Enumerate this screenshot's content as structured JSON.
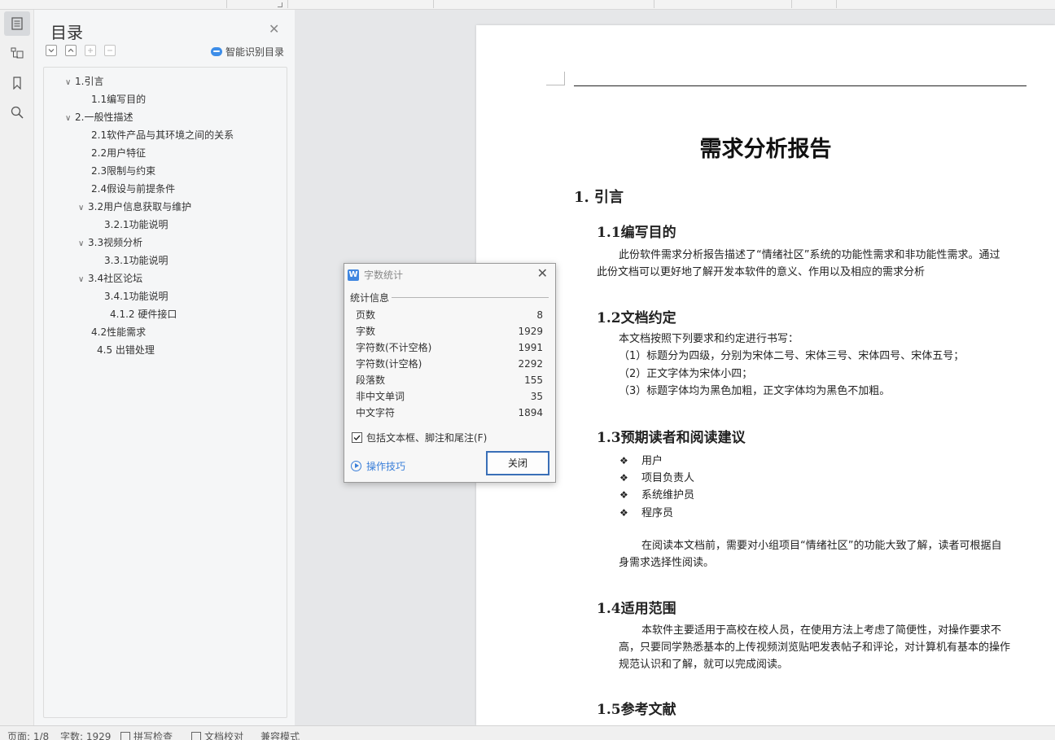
{
  "nav": {
    "title": "目录",
    "smart_toc_label": "智能识别目录",
    "items": [
      {
        "label": "1.引言",
        "level": 1,
        "expanded": true
      },
      {
        "label": "1.1编写目的",
        "level": 2
      },
      {
        "label": "2.一般性描述",
        "level": 1,
        "expanded": true
      },
      {
        "label": "2.1软件产品与其环境之间的关系",
        "level": 2
      },
      {
        "label": "2.2用户特征",
        "level": 2
      },
      {
        "label": "2.3限制与约束",
        "level": 2
      },
      {
        "label": "2.4假设与前提条件",
        "level": 2
      },
      {
        "label": "3.2用户信息获取与维护",
        "level": 2,
        "expanded": true
      },
      {
        "label": "3.2.1功能说明",
        "level": 3
      },
      {
        "label": "3.3视频分析",
        "level": 2,
        "expanded": true
      },
      {
        "label": "3.3.1功能说明",
        "level": 3
      },
      {
        "label": "3.4社区论坛",
        "level": 2,
        "expanded": true
      },
      {
        "label": "3.4.1功能说明",
        "level": 3
      },
      {
        "label": "4.1.2 硬件接口",
        "level": 3
      },
      {
        "label": "4.2性能需求",
        "level": 2
      },
      {
        "label": "4.5 出错处理",
        "level": 2
      }
    ]
  },
  "document": {
    "title": "需求分析报告",
    "h1_intro": "1.  引言",
    "s11_title": "1.1编写目的",
    "s11_p1": "此份软件需求分析报告描述了“情绪社区”系统的功能性需求和非功能性需求。通过",
    "s11_p2": "此份文档可以更好地了解开发本软件的意义、作用以及相应的需求分析",
    "s12_title": "1.2文档约定",
    "s12_lines": [
      "本文档按照下列要求和约定进行书写：",
      "（1）标题分为四级，分别为宋体二号、宋体三号、宋体四号、宋体五号；",
      "（2）正文字体为宋体小四；",
      "（3）标题字体均为黑色加粗，正文字体均为黑色不加粗。"
    ],
    "s13_title": "1.3预期读者和阅读建议",
    "s13_bullets": [
      "用户",
      "项目负责人",
      "系统维护员",
      "程序员"
    ],
    "s13_p1": "在阅读本文档前，需要对小组项目“情绪社区”的功能大致了解，读者可根据自",
    "s13_p2": "身需求选择性阅读。",
    "s14_title": "1.4适用范围",
    "s14_p1": "本软件主要适用于高校在校人员，在使用方法上考虑了简便性，对操作要求不",
    "s14_p2": "高，只要同学熟悉基本的上传视频浏览贴吧发表帖子和评论，对计算机有基本的操作",
    "s14_p3": "规范认识和了解，就可以完成阅读。",
    "s15_title": "1.5参考文献"
  },
  "dialog": {
    "title": "字数统计",
    "section": "统计信息",
    "stats": [
      {
        "label": "页数",
        "value": "8"
      },
      {
        "label": "字数",
        "value": "1929"
      },
      {
        "label": "字符数(不计空格)",
        "value": "1991"
      },
      {
        "label": "字符数(计空格)",
        "value": "2292"
      },
      {
        "label": "段落数",
        "value": "155"
      },
      {
        "label": "非中文单词",
        "value": "35"
      },
      {
        "label": "中文字符",
        "value": "1894"
      }
    ],
    "checkbox_label": "包括文本框、脚注和尾注(F)",
    "checkbox_checked": true,
    "tips_label": "操作技巧",
    "close_label": "关闭"
  },
  "status": {
    "page": "页面: 1/8",
    "words": "字数: 1929",
    "spell": "拼写检查",
    "proof": "文档校对",
    "compat": "兼容模式"
  }
}
